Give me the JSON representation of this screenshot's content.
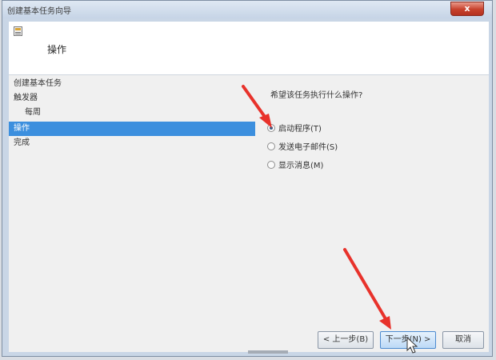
{
  "window": {
    "title": "创建基本任务向导",
    "close_label": "x"
  },
  "header": {
    "title": "操作"
  },
  "nav": {
    "items": [
      {
        "label": "创建基本任务"
      },
      {
        "label": "触发器"
      },
      {
        "label": "每周"
      },
      {
        "label": "操作"
      },
      {
        "label": "完成"
      }
    ]
  },
  "main": {
    "question": "希望该任务执行什么操作?",
    "options": [
      {
        "label": "启动程序(T)",
        "selected": true
      },
      {
        "label": "发送电子邮件(S)",
        "selected": false
      },
      {
        "label": "显示消息(M)",
        "selected": false
      }
    ]
  },
  "buttons": {
    "back_label": "< 上一步(B)",
    "next_label": "下一步(N) >",
    "cancel_label": "取消"
  },
  "colors": {
    "selection": "#3c8fde",
    "annotation_arrow": "#e8322b",
    "close_button": "#c7412c"
  }
}
